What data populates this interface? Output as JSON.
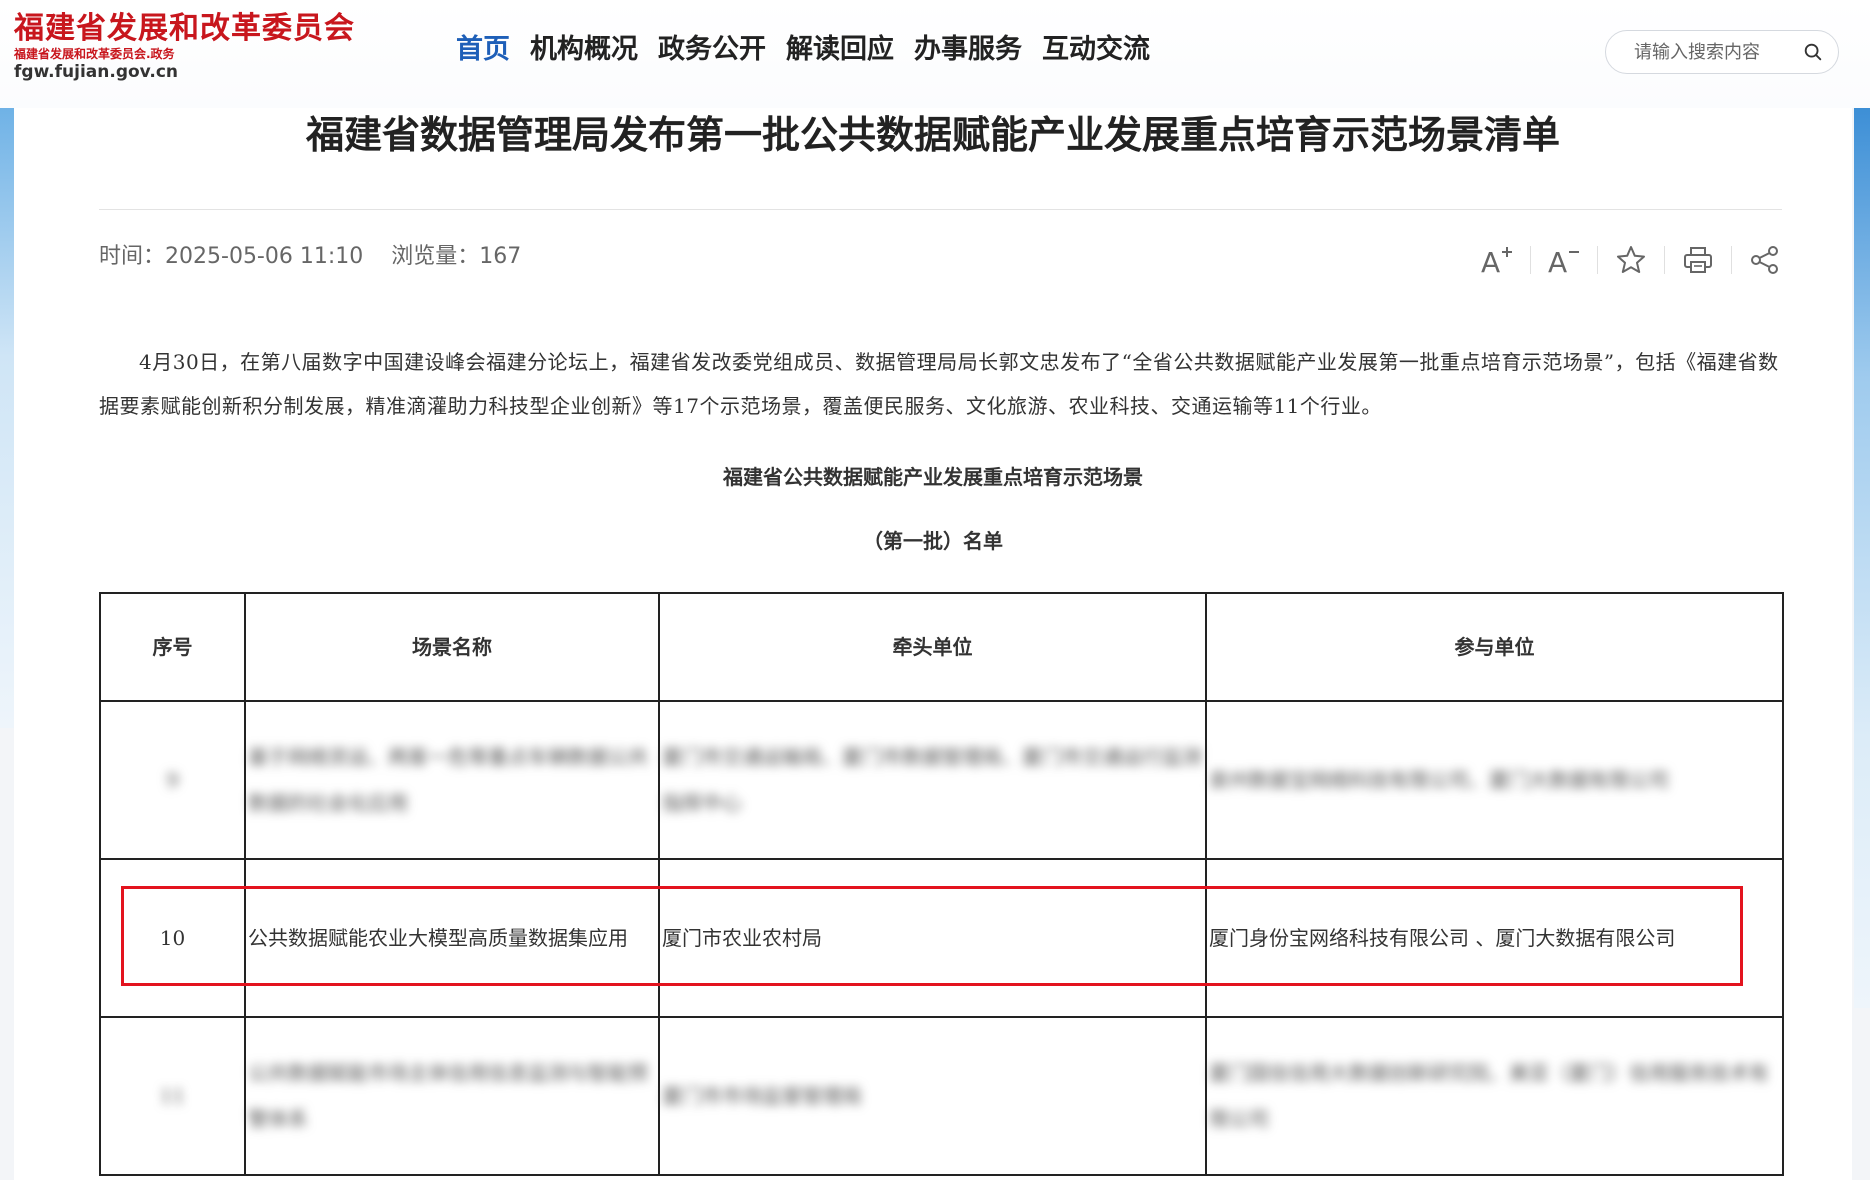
{
  "logo": {
    "title": "福建省发展和改革委员会",
    "subtitle": "福建省发展和改革委员会.政务",
    "url": "fgw.fujian.gov.cn"
  },
  "nav": {
    "items": [
      {
        "label": "首页",
        "active": true
      },
      {
        "label": "机构概况",
        "active": false
      },
      {
        "label": "政务公开",
        "active": false
      },
      {
        "label": "解读回应",
        "active": false
      },
      {
        "label": "办事服务",
        "active": false
      },
      {
        "label": "互动交流",
        "active": false
      }
    ]
  },
  "search": {
    "placeholder": "请输入搜索内容",
    "icon": "search-icon"
  },
  "article": {
    "title": "福建省数据管理局发布第一批公共数据赋能产业发展重点培育示范场景清单",
    "time_label": "时间：",
    "time_value": "2025-05-06 11:10",
    "views_label": "浏览量：",
    "views_value": "167",
    "paragraph": "4月30日，在第八届数字中国建设峰会福建分论坛上，福建省发改委党组成员、数据管理局局长郭文忠发布了“全省公共数据赋能产业发展第一批重点培育示范场景”，包括《福建省数据要素赋能创新积分制发展，精准滴灌助力科技型企业创新》等17个示范场景，覆盖便民服务、文化旅游、农业科技、交通运输等11个行业。",
    "caption_line1": "福建省公共数据赋能产业发展重点培育示范场景",
    "caption_line2": "（第一批）名单"
  },
  "tools": [
    {
      "icon": "font-increase-icon"
    },
    {
      "icon": "font-decrease-icon"
    },
    {
      "icon": "star-icon"
    },
    {
      "icon": "print-icon"
    },
    {
      "icon": "share-icon"
    }
  ],
  "table": {
    "headers": [
      "序号",
      "场景名称",
      "牵头单位",
      "参与单位"
    ],
    "rows": [
      {
        "num": "9",
        "name": "基于网络货运、两客一危等重点车辆数据公共数据的社会化应用",
        "lead": "厦门市交通运输局、厦门市数据管理局、厦门市交通运行监测指挥中心",
        "partners": "泉州数据宝网络科技有限公司、厦门大数据有限公司",
        "blurred": true
      },
      {
        "num": "10",
        "name": "公共数据赋能农业大模型高质量数据集应用",
        "lead": "厦门市农业农村局",
        "partners": "厦门身份宝网络科技有限公司 、厦门大数据有限公司",
        "blurred": false
      },
      {
        "num": "11",
        "name": "公共数据赋能市场主体信用信息监测与智能预警体系",
        "lead": "厦门市市场监督管理局",
        "partners": "厦门国信信用大数据创新研究院、美亚（厦门）信用服务技术有限公司",
        "blurred": true
      }
    ]
  },
  "colors": {
    "brand_red": "#c8161d",
    "nav_active": "#1e5fb8",
    "highlight": "#e3131e"
  }
}
